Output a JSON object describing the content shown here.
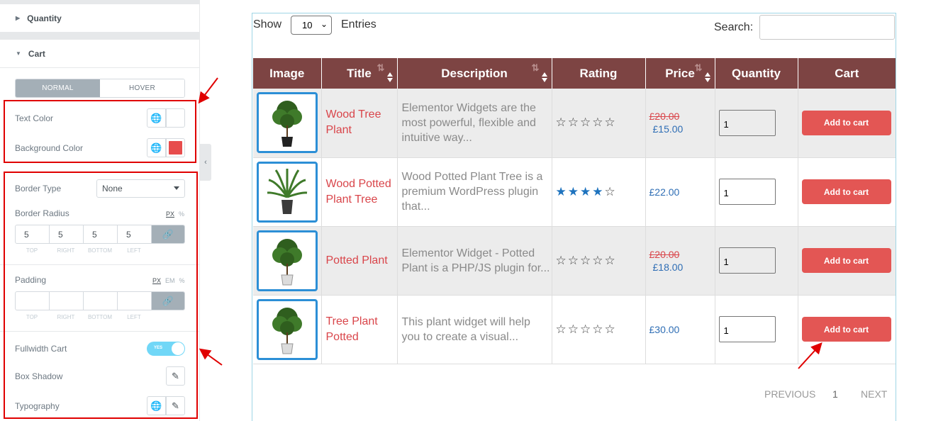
{
  "panel": {
    "quantity_section": "Quantity",
    "cart_section": "Cart",
    "tabs": {
      "normal": "NORMAL",
      "hover": "HOVER"
    },
    "text_color_label": "Text Color",
    "background_color_label": "Background Color",
    "background_color_value": "#e74c4c",
    "border_type_label": "Border Type",
    "border_type_value": "None",
    "border_radius_label": "Border Radius",
    "border_radius": {
      "top": "5",
      "right": "5",
      "bottom": "5",
      "left": "5"
    },
    "padding_label": "Padding",
    "units": {
      "px": "PX",
      "em": "EM",
      "pct": "%"
    },
    "dim_labels": {
      "top": "TOP",
      "right": "RIGHT",
      "bottom": "BOTTOM",
      "left": "LEFT"
    },
    "fullwidth_label": "Fullwidth Cart",
    "fullwidth_toggle": "YES",
    "box_shadow_label": "Box Shadow",
    "typography_label": "Typography"
  },
  "table_controls": {
    "show_label": "Show",
    "entries_value": "10",
    "entries_label": "Entries",
    "search_label": "Search:",
    "search_value": ""
  },
  "table": {
    "headers": [
      "Image",
      "Title",
      "Description",
      "Rating",
      "Price",
      "Quantity",
      "Cart"
    ],
    "rows": [
      {
        "title": "Wood Tree Plant",
        "description": "Elementor Widgets are the most powerful, flexible and intuitive way...",
        "rating": 0,
        "old_price": "£20.00",
        "price": "£15.00",
        "quantity": "1",
        "cart_label": "Add to cart"
      },
      {
        "title": "Wood Potted Plant Tree",
        "description": "Wood Potted Plant Tree is a premium WordPress plugin that...",
        "rating": 4,
        "old_price": "",
        "price": "£22.00",
        "quantity": "1",
        "cart_label": "Add to cart"
      },
      {
        "title": "Potted Plant",
        "description": "Elementor Widget - Potted Plant is a PHP/JS plugin for...",
        "rating": 0,
        "old_price": "£20.00",
        "price": "£18.00",
        "quantity": "1",
        "cart_label": "Add to cart"
      },
      {
        "title": "Tree Plant Potted",
        "description": "This plant widget will help you to create a visual...",
        "rating": 0,
        "old_price": "",
        "price": "£30.00",
        "quantity": "1",
        "cart_label": "Add to cart"
      }
    ]
  },
  "pagination": {
    "previous": "PREVIOUS",
    "page": "1",
    "next": "NEXT"
  },
  "colors": {
    "header_bg": "#7d4443",
    "accent_red": "#e35654",
    "annotation_red": "#e00000",
    "star_blue": "#1e73be"
  }
}
